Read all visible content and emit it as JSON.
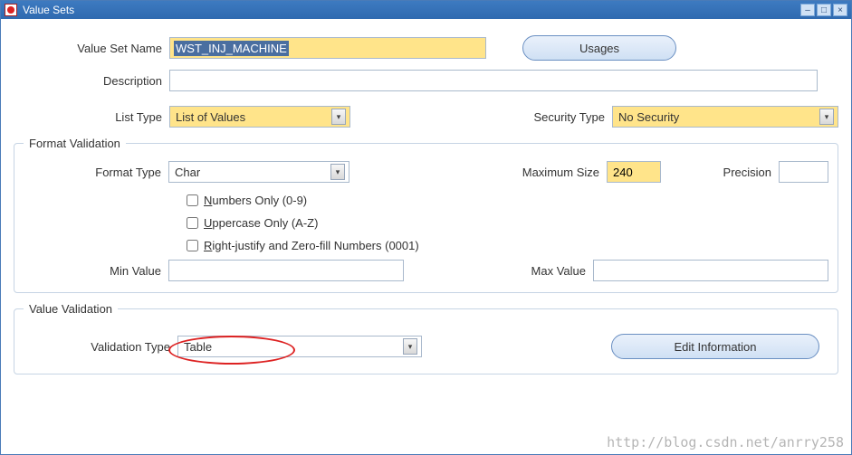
{
  "window": {
    "title": "Value Sets"
  },
  "labels": {
    "value_set_name": "Value Set Name",
    "description": "Description",
    "list_type": "List Type",
    "security_type": "Security Type",
    "format_validation": "Format Validation",
    "format_type": "Format Type",
    "maximum_size": "Maximum Size",
    "precision": "Precision",
    "min_value": "Min Value",
    "max_value": "Max Value",
    "value_validation": "Value Validation",
    "validation_type": "Validation Type"
  },
  "buttons": {
    "usages": "Usages",
    "edit_information": "Edit Information"
  },
  "fields": {
    "value_set_name": "WST_INJ_MACHINE",
    "description": "",
    "list_type": "List of Values",
    "security_type": "No Security",
    "format_type": "Char",
    "maximum_size": "240",
    "precision": "",
    "min_value": "",
    "max_value": "",
    "validation_type": "Table"
  },
  "checkboxes": {
    "numbers_only": {
      "label_pre": "N",
      "label_rest": "umbers Only (0-9)",
      "checked": false
    },
    "uppercase_only": {
      "label_pre": "U",
      "label_rest": "ppercase Only (A-Z)",
      "checked": false
    },
    "right_justify": {
      "label_pre": "R",
      "label_rest": "ight-justify and Zero-fill Numbers (0001)",
      "checked": false
    }
  },
  "watermark": "http://blog.csdn.net/anrry258"
}
